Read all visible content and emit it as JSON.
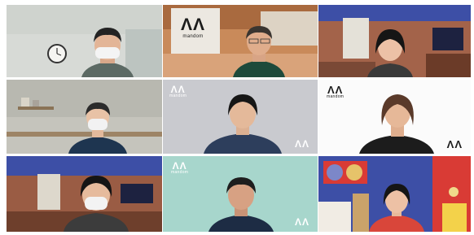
{
  "meeting": {
    "brand_label": "mandom",
    "logo_mark": "ΛΛ",
    "participants": [
      {
        "id": "p1",
        "background": "office-clock"
      },
      {
        "id": "p2",
        "background": "mandom-lobby"
      },
      {
        "id": "p3",
        "background": "living-room-blue"
      },
      {
        "id": "p4",
        "background": "kitchen-shelf"
      },
      {
        "id": "p5",
        "background": "grey-brand"
      },
      {
        "id": "p6",
        "background": "white-brand"
      },
      {
        "id": "p7",
        "background": "living-room-blue"
      },
      {
        "id": "p8",
        "background": "mint-brand"
      },
      {
        "id": "p9",
        "background": "colorful-room"
      }
    ]
  },
  "colors": {
    "brand_dark": "#1b1b1b",
    "grey_panel": "#c9cacf",
    "mint_panel": "#a7d6cc",
    "room_blue": "#3d4fa6"
  }
}
